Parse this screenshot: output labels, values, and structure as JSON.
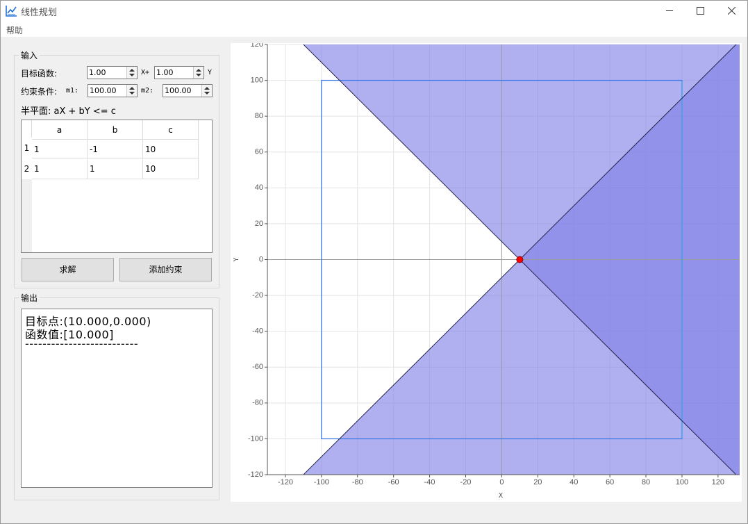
{
  "window": {
    "title": "线性规划",
    "menu_help": "帮助"
  },
  "input": {
    "group_title": "输入",
    "objective_label": "目标函数:",
    "obj_x_value": "1.00",
    "x_plus": "X+",
    "obj_y_value": "1.00",
    "y_label": "Y",
    "constraint_label": "约束条件:",
    "m1_label": "m1:",
    "m1_value": "100.00",
    "m2_label": "m2:",
    "m2_value": "100.00",
    "halfplane_label": "半平面: aX + bY <= c",
    "table": {
      "headers": [
        "a",
        "b",
        "c"
      ],
      "row_headers": [
        "1",
        "2"
      ],
      "rows": [
        [
          "1",
          "-1",
          "10"
        ],
        [
          "1",
          "1",
          "10"
        ]
      ]
    },
    "solve_button": "求解",
    "add_constraint_button": "添加约束"
  },
  "output": {
    "group_title": "输出",
    "target_point": "目标点:(10.000,0.000)",
    "function_value": "函数值:[10.000]",
    "separator": "--------------------------"
  },
  "chart_data": {
    "type": "area",
    "xlabel": "X",
    "ylabel": "Y",
    "xlim": [
      -130,
      132
    ],
    "ylim": [
      -120,
      120
    ],
    "xticks": [
      -120,
      -100,
      -80,
      -60,
      -40,
      -20,
      0,
      20,
      40,
      60,
      80,
      100,
      120
    ],
    "yticks": [
      120,
      100,
      80,
      60,
      40,
      20,
      0,
      -20,
      -40,
      -60,
      -80,
      -100,
      -120
    ],
    "grid": true,
    "bounding_box": {
      "x": [
        -100,
        100
      ],
      "y": [
        -100,
        100
      ]
    },
    "constraints": [
      {
        "a": 1,
        "b": -1,
        "c": 10
      },
      {
        "a": 1,
        "b": 1,
        "c": 10
      }
    ],
    "optimal_point": {
      "x": 10,
      "y": 0
    },
    "colors": {
      "halfplane_fill": "#8080e6",
      "box": "#3a78e6",
      "box_right": "#40a8e8",
      "optimal_point": "#ff0000",
      "line": "#22224a"
    }
  }
}
